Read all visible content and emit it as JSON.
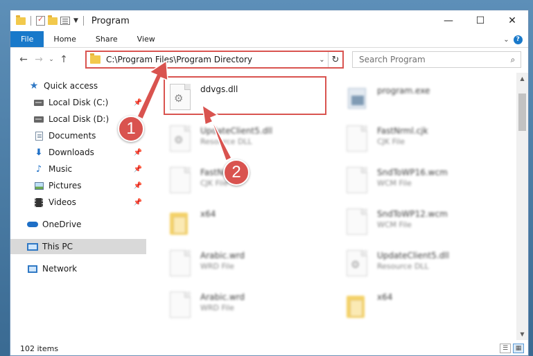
{
  "window": {
    "title": "Program"
  },
  "ribbon": {
    "tabs": [
      "File",
      "Home",
      "Share",
      "View"
    ]
  },
  "address": {
    "path": "C:\\Program Files\\Program Directory"
  },
  "search": {
    "placeholder": "Search Program"
  },
  "sidebar": {
    "items": [
      {
        "label": "Quick access",
        "icon": "star-icon"
      },
      {
        "label": "Local Disk (C:)",
        "icon": "drive-icon",
        "pinned": true
      },
      {
        "label": "Local Disk (D:)",
        "icon": "drive-icon",
        "pinned": false
      },
      {
        "label": "Documents",
        "icon": "documents-icon",
        "pinned": true
      },
      {
        "label": "Downloads",
        "icon": "download-icon",
        "pinned": true
      },
      {
        "label": "Music",
        "icon": "music-icon",
        "pinned": true
      },
      {
        "label": "Pictures",
        "icon": "pictures-icon",
        "pinned": true
      },
      {
        "label": "Videos",
        "icon": "videos-icon",
        "pinned": true
      },
      {
        "label": "OneDrive",
        "icon": "onedrive-icon"
      },
      {
        "label": "This PC",
        "icon": "pc-icon",
        "selected": true
      },
      {
        "label": "Network",
        "icon": "network-icon"
      }
    ]
  },
  "files": [
    {
      "name": "ddvgs.dll",
      "type": "",
      "icon": "dll-gear-icon"
    },
    {
      "name": "program.exe",
      "type": "",
      "icon": "exe-icon"
    },
    {
      "name": "UpdateClient5.dll",
      "type": "Resource DLL",
      "icon": "dll-gear-icon"
    },
    {
      "name": "FastNrml.cjk",
      "type": "CJK File",
      "icon": "document-icon"
    },
    {
      "name": "FastNr",
      "type": "CJK File",
      "icon": "document-icon"
    },
    {
      "name": "SndToWP16.wcm",
      "type": "WCM File",
      "icon": "document-icon"
    },
    {
      "name": "x64",
      "type": "",
      "icon": "folder-icon"
    },
    {
      "name": "SndToWP12.wcm",
      "type": "WCM File",
      "icon": "document-icon"
    },
    {
      "name": "Arabic.wrd",
      "type": "WRD File",
      "icon": "document-icon"
    },
    {
      "name": "UpdateClient5.dll",
      "type": "Resource DLL",
      "icon": "dll-gear-icon"
    },
    {
      "name": "Arabic.wrd",
      "type": "WRD File",
      "icon": "document-icon"
    },
    {
      "name": "x64",
      "type": "",
      "icon": "folder-icon"
    }
  ],
  "status": {
    "count": "102 items"
  },
  "annotations": {
    "step1": "1",
    "step2": "2"
  },
  "colors": {
    "accent": "#1979ca",
    "highlight": "#d9534f"
  }
}
